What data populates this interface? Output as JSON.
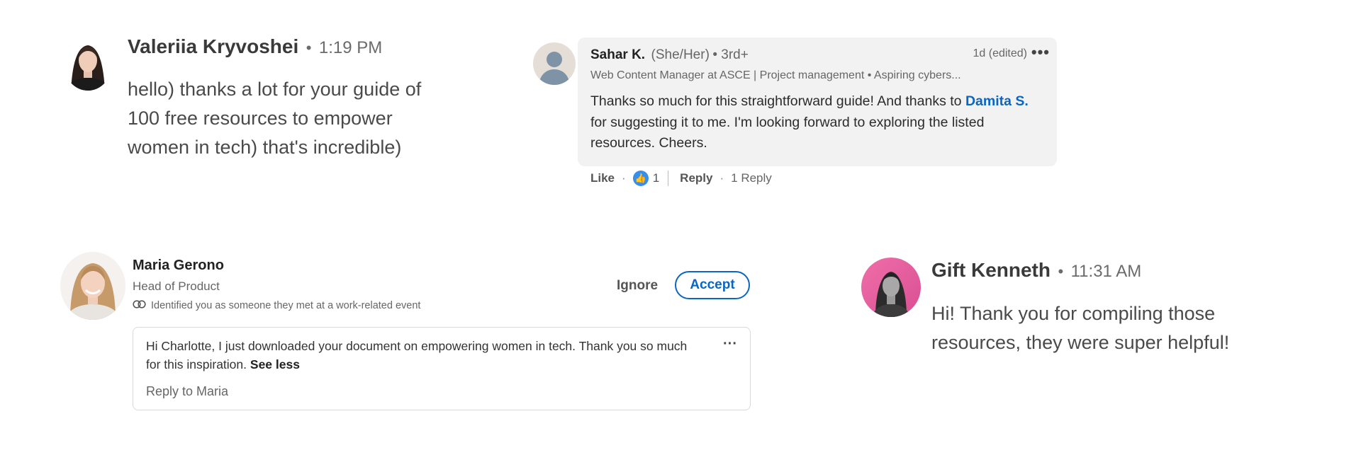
{
  "valeriia": {
    "name": "Valeriia Kryvoshei",
    "separator": "•",
    "time": "1:19 PM",
    "message": "hello) thanks a lot for your guide of 100 free resources to empower women in tech) that's incredible)"
  },
  "sahar": {
    "name": "Sahar K.",
    "pronouns": "(She/Her)",
    "degree": "• 3rd+",
    "meta": "1d (edited)",
    "more_icon": "ellipsis-icon",
    "headline": "Web Content Manager at ASCE | Project management • Aspiring cybers...",
    "body_before": "Thanks so much for this straightforward guide! And thanks to ",
    "mention": "Damita S.",
    "body_after": " for suggesting it to me. I'm looking forward to exploring the listed resources. Cheers.",
    "like_label": "Like",
    "dot": "·",
    "like_count": "1",
    "reply_label": "Reply",
    "reply_count": "1 Reply"
  },
  "maria": {
    "name": "Maria Gerono",
    "title": "Head of Product",
    "reason": "Identified you as someone they met at a work-related event",
    "ignore_label": "Ignore",
    "accept_label": "Accept",
    "message": "Hi Charlotte, I just downloaded your document on empowering women in tech. Thank you so much for this inspiration.",
    "see_less": "See less",
    "more_icon": "ellipsis-icon",
    "reply_label": "Reply to Maria"
  },
  "gift": {
    "name": "Gift Kenneth",
    "separator": "•",
    "time": "11:31 AM",
    "message": "Hi! Thank you for compiling those resources, they were super helpful!"
  },
  "colors": {
    "link_blue": "#0a66c2",
    "like_blue": "#378fe9",
    "bubble_gray": "#f2f2f2"
  }
}
